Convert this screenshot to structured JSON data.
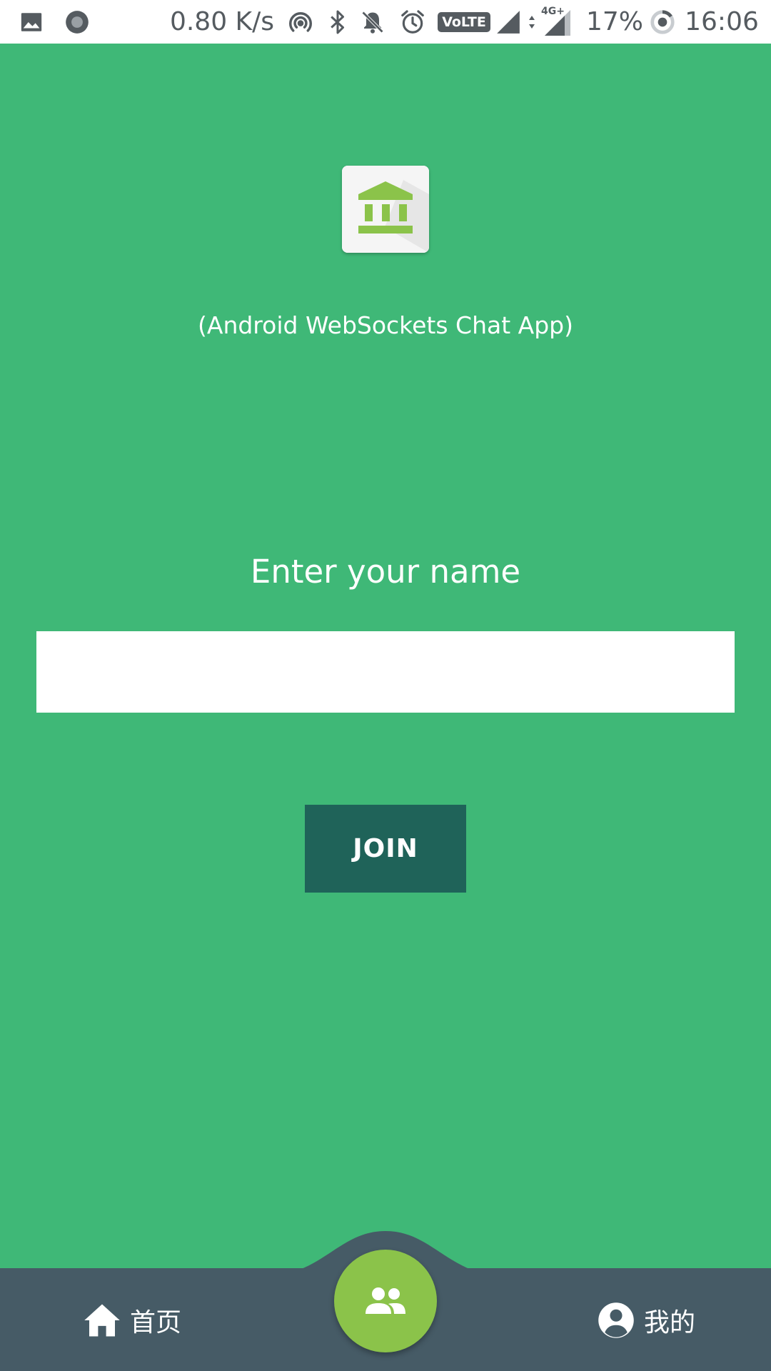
{
  "status_bar": {
    "network_speed": "0.80 K/s",
    "volte_label": "VoLTE",
    "network_type": "4G+",
    "battery": "17%",
    "time": "16:06",
    "icons": [
      "gallery-icon",
      "record-icon",
      "hotspot-icon",
      "bluetooth-icon",
      "mute-icon",
      "alarm-icon",
      "volte-icon",
      "signal-icon",
      "signal-4g-icon",
      "battery-icon"
    ]
  },
  "main": {
    "logo_icon": "bank-icon",
    "subtitle": "(Android WebSockets Chat App)",
    "prompt": "Enter your name",
    "name_input": {
      "value": "",
      "placeholder": ""
    },
    "join_label": "JOIN"
  },
  "bottom_nav": {
    "home_label": "首页",
    "home_icon": "home-icon",
    "center_icon": "group-icon",
    "profile_label": "我的",
    "profile_icon": "account-circle-icon"
  },
  "colors": {
    "background": "#3fb877",
    "join_button": "#1f6359",
    "bottom_nav": "#465b66",
    "fab": "#8bc34a",
    "logo_accent": "#8bc34a",
    "status_bar_icons": "#555b60"
  }
}
